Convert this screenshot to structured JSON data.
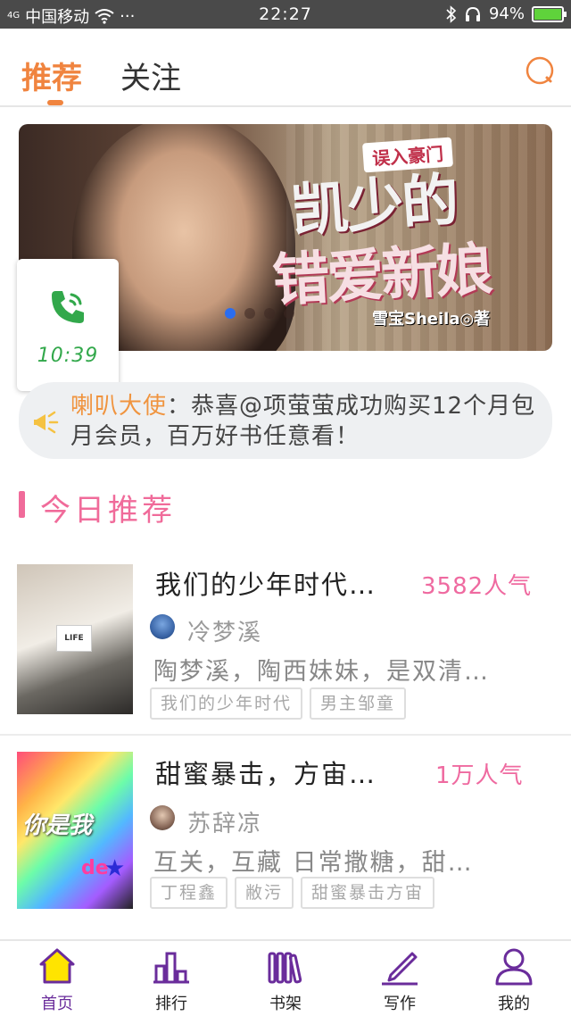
{
  "status_bar": {
    "signal": "4G",
    "carrier": "中国移动",
    "more": "···",
    "time": "22:27",
    "battery": "94%"
  },
  "header": {
    "tabs": [
      {
        "label": "推荐",
        "active": true
      },
      {
        "label": "关注",
        "active": false
      }
    ],
    "search_icon": "search-icon"
  },
  "banner": {
    "subtitle": "误入豪门",
    "title_line1": "凯少的",
    "title_line2": "错爱新娘",
    "author": "雪宝Sheila◎著",
    "page_count": 4,
    "active_page": 1
  },
  "call_bubble": {
    "icon": "phone-icon",
    "time": "10:39"
  },
  "notice": {
    "icon": "megaphone-icon",
    "speaker": "喇叭大使",
    "message": "：恭喜@项萤萤成功购买12个月包月会员，百万好书任意看！"
  },
  "section": {
    "title": "今日推荐"
  },
  "books": [
    {
      "title": "我们的少年时代…",
      "popularity": "3582人气",
      "author": "冷梦溪",
      "description": "陶梦溪，陶西妹妹，是双清…",
      "tags": [
        "我们的少年时代",
        "男主邹童"
      ],
      "cover_text": "LIFE"
    },
    {
      "title": "甜蜜暴击，方宙…",
      "popularity": "1万人气",
      "author": "苏辞凉",
      "description": "互关，互藏 日常撒糖，甜…",
      "tags": [
        "丁程鑫",
        "敝污",
        "甜蜜暴击方宙"
      ],
      "cover_text": "你是我",
      "cover_text2": "de"
    }
  ],
  "bottom_nav": [
    {
      "label": "首页",
      "icon": "home-icon",
      "active": true
    },
    {
      "label": "排行",
      "icon": "ranking-icon",
      "active": false
    },
    {
      "label": "书架",
      "icon": "bookshelf-icon",
      "active": false
    },
    {
      "label": "写作",
      "icon": "pen-icon",
      "active": false
    },
    {
      "label": "我的",
      "icon": "profile-icon",
      "active": false
    }
  ],
  "colors": {
    "accent_orange": "#f0843f",
    "accent_pink": "#f06b9a",
    "nav_purple": "#6a2c9b",
    "home_yellow": "#ffe400",
    "call_green": "#32a84b"
  }
}
